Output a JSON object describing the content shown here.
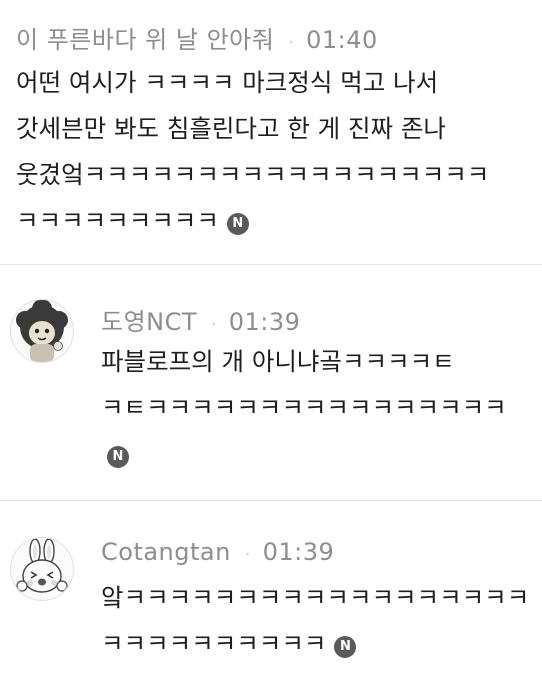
{
  "comments": [
    {
      "author": "이 푸른바다 위 날 안아줘",
      "time": "01:40",
      "lines": [
        "어떤 여시가 ㅋㅋㅋㅋ 마크정식 먹고 나서",
        "갓세븐만 봐도 침흘린다고 한 게 진짜 존나",
        "웃겼엌ㅋㅋㅋㅋㅋㅋㅋㅋㅋㅋㅋㅋㅋㅋㅋㅋㅋㅋ",
        "ㅋㅋㅋㅋㅋㅋㅋㅋㅋ"
      ],
      "badge": "N",
      "has_avatar": false
    },
    {
      "author": "도영NCT",
      "time": "01:39",
      "lines": [
        "파블로프의 개 아니냐곸ㅋㅋㅋㅋㅌ",
        "ㅋㅌㅋㅋㅋㅋㅋㅋㅋㅋㅋㅋㅋㅋㅋㅋㅋㅋ",
        ""
      ],
      "badge": "N",
      "avatar_icon": "afro-character-avatar-icon"
    },
    {
      "author": "Cotangtan",
      "time": "01:39",
      "lines": [
        "앜ㅋㅋㅋㅋㅋㅋㅋㅋㅋㅋㅋㅋㅋㅋㅋㅋㅋㅋ",
        "ㅋㅋㅋㅋㅋㅋㅋㅋㅋㅋ"
      ],
      "badge": "N",
      "avatar_icon": "rabbit-character-avatar-icon"
    }
  ],
  "separator": "·",
  "colors": {
    "meta_gray": "#8e8e8e",
    "divider": "#e4e4e4",
    "badge": "#5a5a5a"
  }
}
